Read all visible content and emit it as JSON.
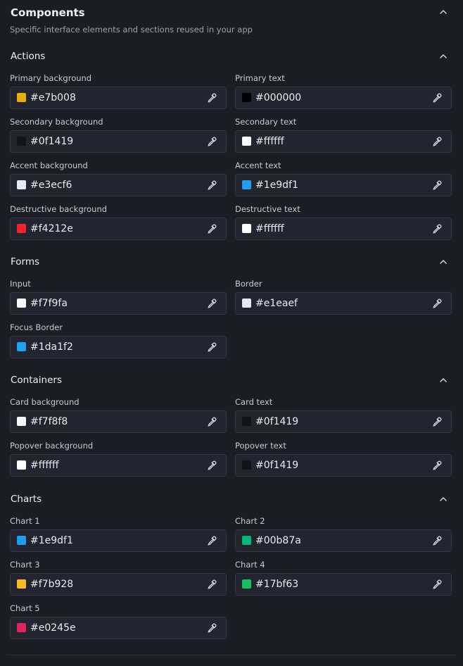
{
  "header": {
    "title": "Components",
    "description": "Specific interface elements and sections reused in your app"
  },
  "sections": [
    {
      "title": "Actions",
      "fields": [
        {
          "label": "Primary background",
          "value": "#e7b008",
          "swatch": "#e7b008"
        },
        {
          "label": "Primary text",
          "value": "#000000",
          "swatch": "#000000"
        },
        {
          "label": "Secondary background",
          "value": "#0f1419",
          "swatch": "#0f1419"
        },
        {
          "label": "Secondary text",
          "value": "#ffffff",
          "swatch": "#ffffff"
        },
        {
          "label": "Accent background",
          "value": "#e3ecf6",
          "swatch": "#e3ecf6"
        },
        {
          "label": "Accent text",
          "value": "#1e9df1",
          "swatch": "#1e9df1"
        },
        {
          "label": "Destructive background",
          "value": "#f4212e",
          "swatch": "#f4212e"
        },
        {
          "label": "Destructive text",
          "value": "#ffffff",
          "swatch": "#ffffff"
        }
      ]
    },
    {
      "title": "Forms",
      "fields": [
        {
          "label": "Input",
          "value": "#f7f9fa",
          "swatch": "#f7f9fa"
        },
        {
          "label": "Border",
          "value": "#e1eaef",
          "swatch": "#e1eaef"
        },
        {
          "label": "Focus Border",
          "value": "#1da1f2",
          "swatch": "#1da1f2"
        }
      ]
    },
    {
      "title": "Containers",
      "fields": [
        {
          "label": "Card background",
          "value": "#f7f8f8",
          "swatch": "#f7f8f8"
        },
        {
          "label": "Card text",
          "value": "#0f1419",
          "swatch": "#0f1419"
        },
        {
          "label": "Popover background",
          "value": "#ffffff",
          "swatch": "#ffffff"
        },
        {
          "label": "Popover text",
          "value": "#0f1419",
          "swatch": "#0f1419"
        }
      ]
    },
    {
      "title": "Charts",
      "fields": [
        {
          "label": "Chart 1",
          "value": "#1e9df1",
          "swatch": "#1e9df1"
        },
        {
          "label": "Chart 2",
          "value": "#00b87a",
          "swatch": "#00b87a"
        },
        {
          "label": "Chart 3",
          "value": "#f7b928",
          "swatch": "#f7b928"
        },
        {
          "label": "Chart 4",
          "value": "#17bf63",
          "swatch": "#17bf63"
        },
        {
          "label": "Chart 5",
          "value": "#e0245e",
          "swatch": "#e0245e"
        }
      ]
    }
  ],
  "icons": {
    "collapse": "chevron-up-icon",
    "picker": "eyedropper-icon"
  }
}
